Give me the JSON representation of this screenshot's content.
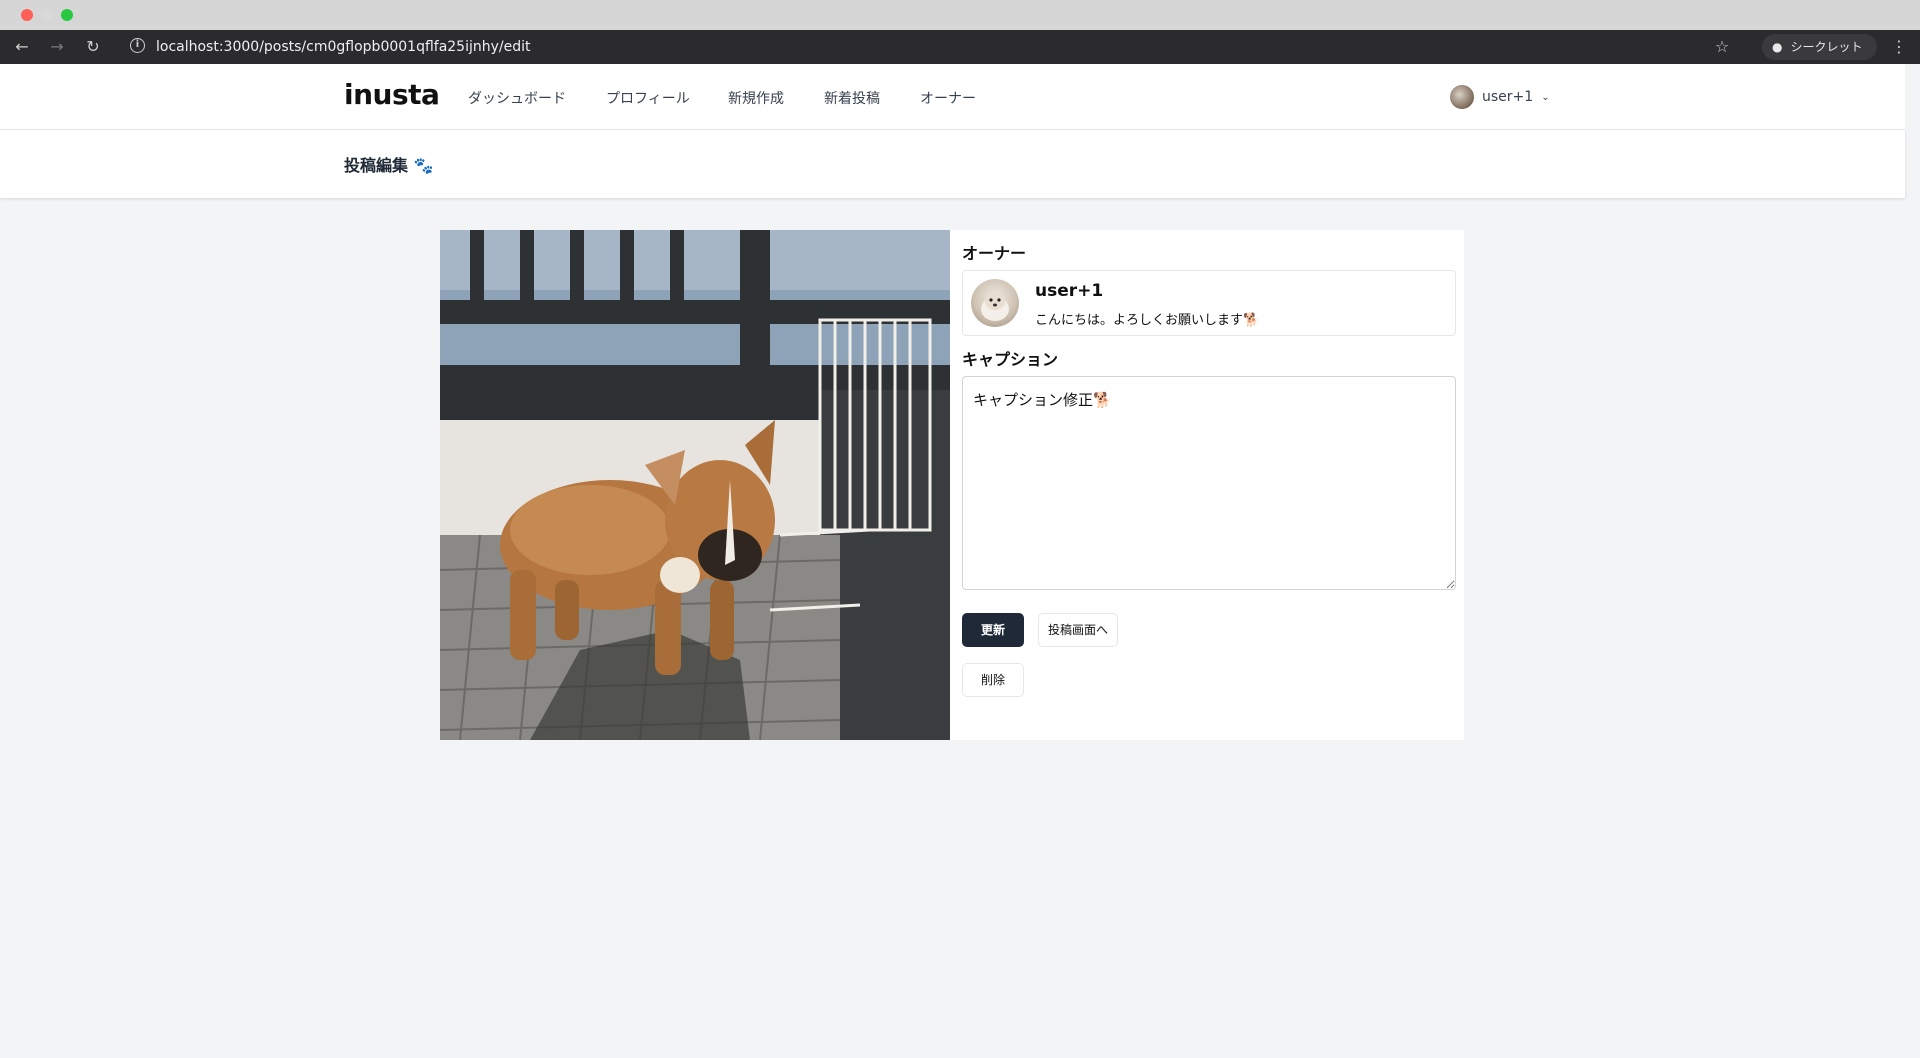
{
  "browser": {
    "url": "localhost:3000/posts/cm0gflopb0001qflfa25ijnhy/edit",
    "incognito_label": "シークレット",
    "icons": [
      "back-arrow-icon",
      "forward-arrow-icon",
      "reload-icon",
      "info-icon",
      "star-icon",
      "incognito-icon",
      "kebab-menu-icon"
    ]
  },
  "header": {
    "logo": "inusta",
    "nav": [
      "ダッシュボード",
      "プロフィール",
      "新規作成",
      "新着投稿",
      "オーナー"
    ],
    "user_label": "user+1"
  },
  "page": {
    "title": "投稿編集 🐾"
  },
  "owner_section": {
    "heading": "オーナー",
    "name": "user+1",
    "bio": "こんにちは。よろしくお願いします🐕"
  },
  "caption_section": {
    "heading": "キャプション",
    "value": "キャプション修正🐕"
  },
  "buttons": {
    "update": "更新",
    "to_post": "投稿画面へ",
    "delete": "削除"
  },
  "colors": {
    "primary_button": "#1f2937",
    "page_background": "#f3f4f6"
  }
}
